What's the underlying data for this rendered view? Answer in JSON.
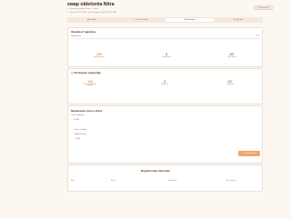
{
  "header": {
    "title": "swap oblečenia Nitra",
    "meta_line_1": "Ponukové sezóna Oslava — Jeseň",
    "meta_line_2": "Piatok 8. 2025 18:00 · Pri Sv. Vojtecha, Nitra, 949 01 Nitra",
    "notifications_label": "Nastavenia"
  },
  "tabs": [
    {
      "label": "Prehľad",
      "icon": "grid-icon"
    },
    {
      "label": "Lístky a Predaj",
      "icon": "ticket-icon"
    },
    {
      "label": "Nastavenia",
      "icon": "gear-icon"
    },
    {
      "label": "Výsledky",
      "icon": "chart-icon"
    }
  ],
  "active_tab_index": 2,
  "registration": {
    "title": "Obsadenosť registrácie",
    "capacity_label": "Obsadenosť",
    "capacity_value": "0%",
    "fill_fraction": 0.0,
    "stats": [
      {
        "value": "200",
        "label": "Celková kapacita",
        "color": "orange"
      },
      {
        "value": "3",
        "label": "Zaregistrovaní",
        "color": "grey"
      },
      {
        "value": "197",
        "label": "Voľné miesta",
        "color": "blue"
      }
    ]
  },
  "vouchers": {
    "title": "Dostupné vstupenky",
    "stats": [
      {
        "value": "120",
        "label": "Dostupné vstupenky",
        "sub": "predajné",
        "color": "orange"
      },
      {
        "value": "3",
        "label": "Registrácie",
        "sub": "",
        "color": "grey"
      },
      {
        "value": "117",
        "label": "Zostávajúce",
        "sub": "",
        "color": "blue"
      }
    ]
  },
  "pricing": {
    "title": "Nastavenie ceny a zľavy",
    "price_label": "Cena vstupného",
    "price_value": "€ 4,00",
    "discount_title": "Zľava s kódom",
    "discount_label": "Hodnota zľavy",
    "discount_value": "% 50",
    "save_label": "Uložiť zmeny"
  },
  "participants": {
    "title": "Registrovaní účastníci",
    "columns": [
      "Meno",
      "E-mail",
      "Registrovaný",
      "Stav registrácie"
    ]
  }
}
